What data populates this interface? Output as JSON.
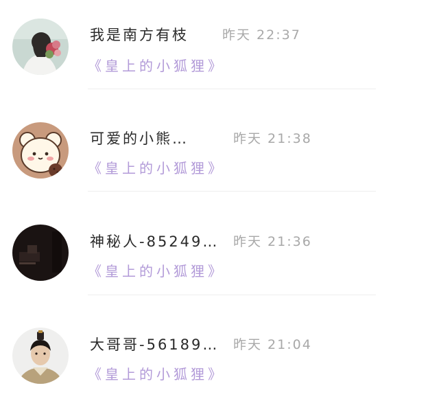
{
  "comments": [
    {
      "name": "我是南方有枝",
      "time": "昨天 22:37",
      "book": "《皇上的小狐狸》",
      "avatar": "girl-with-flowers-avatar"
    },
    {
      "name": "可爱的小熊…",
      "time": "昨天 21:38",
      "book": "《皇上的小狐狸》",
      "avatar": "cartoon-bear-avatar"
    },
    {
      "name": "神秘人-85249…",
      "time": "昨天 21:36",
      "book": "《皇上的小狐狸》",
      "avatar": "dark-piano-avatar"
    },
    {
      "name": "大哥哥-56189…",
      "time": "昨天 21:04",
      "book": "《皇上的小狐狸》",
      "avatar": "costume-prince-avatar"
    }
  ],
  "colors": {
    "name": "#2a2a2a",
    "time": "#a8a8a8",
    "book": "#b29ad8",
    "divider": "#eeeeee"
  }
}
